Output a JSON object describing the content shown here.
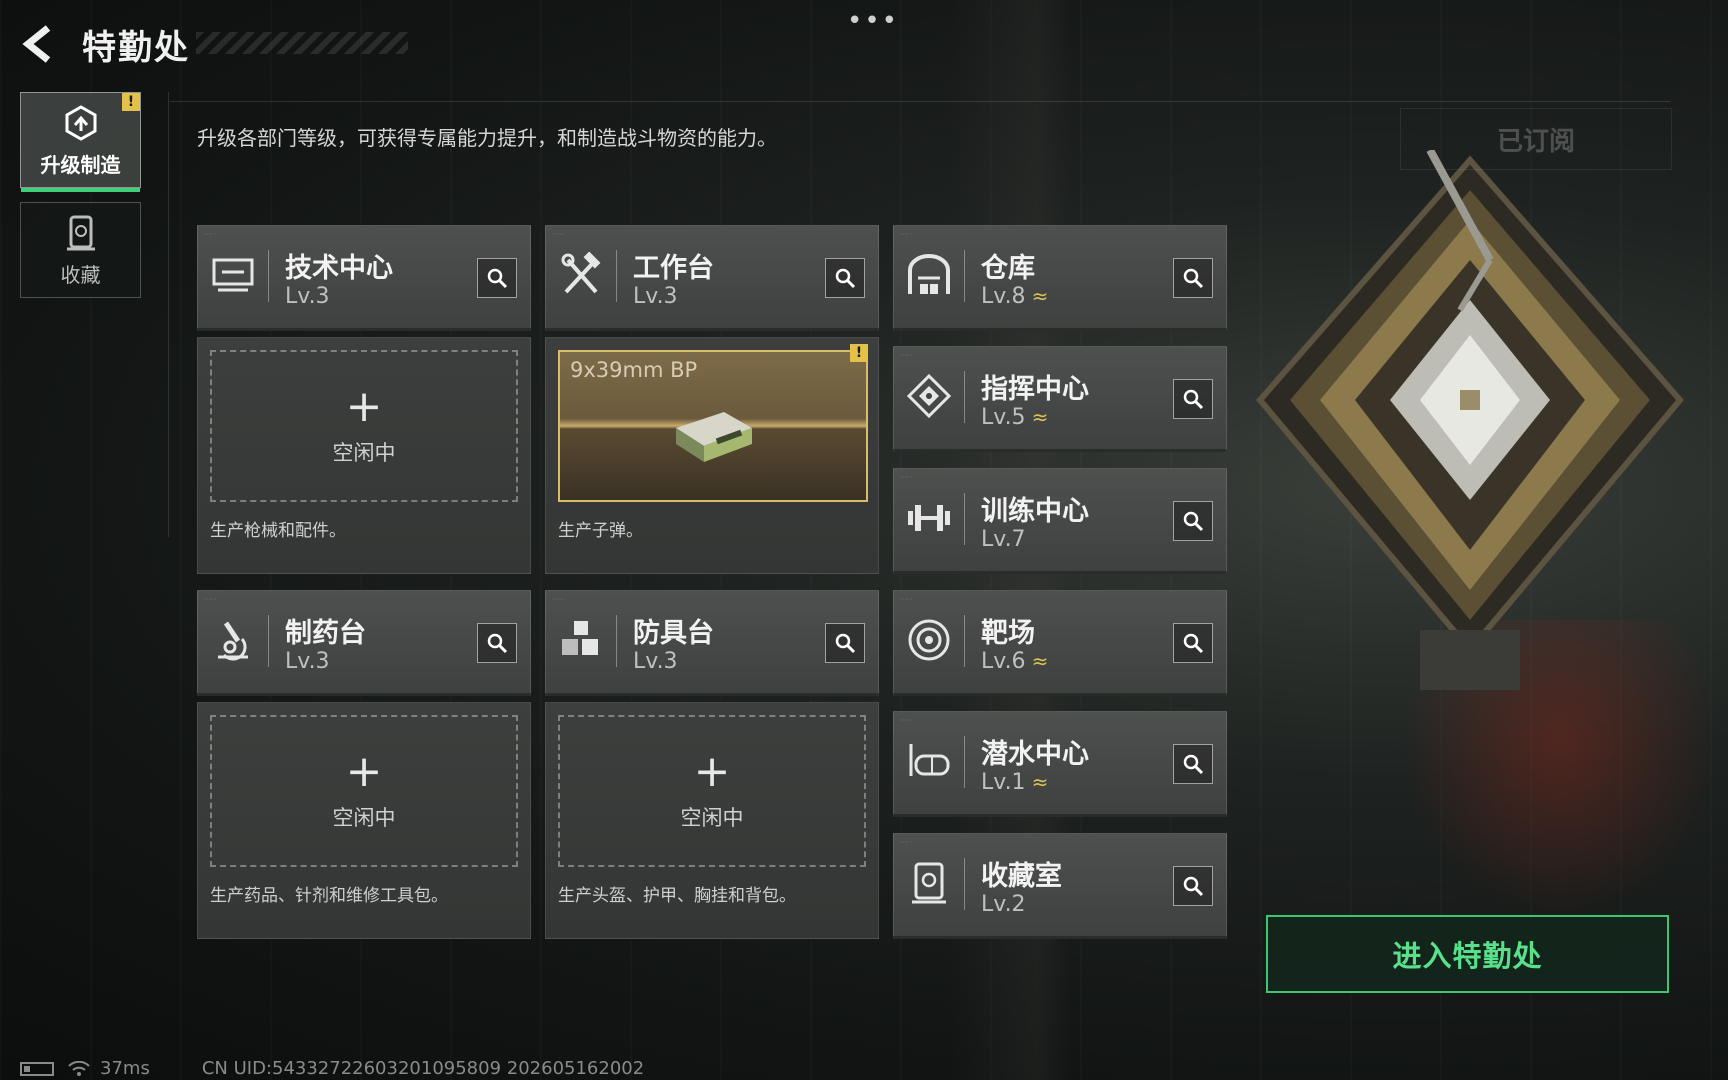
{
  "header": {
    "title": "特勤处",
    "more": "•••"
  },
  "sidebar": [
    {
      "label": "升级制造",
      "active": true,
      "warning": "!"
    },
    {
      "label": "收藏",
      "active": false
    }
  ],
  "description": "升级各部门等级，可获得专属能力提升，和制造战斗物资的能力。",
  "subscribed_label": "已订阅",
  "departments": [
    {
      "name": "技术中心",
      "level": "Lv.3",
      "icon": "computer-icon"
    },
    {
      "name": "工作台",
      "level": "Lv.3",
      "icon": "tools-icon"
    },
    {
      "name": "仓库",
      "level": "Lv.8",
      "upgradable": true,
      "icon": "warehouse-icon"
    },
    {
      "name": "指挥中心",
      "level": "Lv.5",
      "upgradable": true,
      "icon": "command-chip-icon"
    },
    {
      "name": "训练中心",
      "level": "Lv.7",
      "icon": "dumbbell-icon"
    },
    {
      "name": "制药台",
      "level": "Lv.3",
      "icon": "microscope-icon"
    },
    {
      "name": "防具台",
      "level": "Lv.3",
      "icon": "cubes-icon"
    },
    {
      "name": "靶场",
      "level": "Lv.6",
      "upgradable": true,
      "icon": "target-icon"
    },
    {
      "name": "潜水中心",
      "level": "Lv.1",
      "upgradable": true,
      "icon": "diving-mask-icon"
    },
    {
      "name": "收藏室",
      "level": "Lv.2",
      "icon": "collection-icon"
    }
  ],
  "upgrade_arrow": "≈",
  "production": [
    {
      "slot_label": "空闲中",
      "plus": "+",
      "desc": "生产枪械和配件。"
    },
    {
      "item": "9x39mm BP",
      "warning": "!",
      "desc": "生产子弹。"
    },
    {
      "slot_label": "空闲中",
      "plus": "+",
      "desc": "生产药品、针剂和维修工具包。"
    },
    {
      "slot_label": "空闲中",
      "plus": "+",
      "desc": "生产头盔、护甲、胸挂和背包。"
    }
  ],
  "enter_button": "进入特勤处",
  "status_bar": {
    "ping": "37ms",
    "uid": "CN UID:5433272260320109580​9 202605162002"
  },
  "colors": {
    "accent_green": "#3fc56f",
    "warning_yellow": "#e4c24a",
    "upgrade_gold": "#e2c354"
  }
}
